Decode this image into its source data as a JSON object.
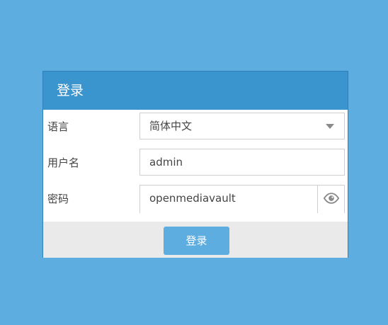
{
  "dialog": {
    "title": "登录"
  },
  "form": {
    "language": {
      "label": "语言",
      "value": "简体中文",
      "icon": "chevron-down-icon"
    },
    "username": {
      "label": "用户名",
      "value": "admin"
    },
    "password": {
      "label": "密码",
      "value": "openmediavault",
      "icon": "eye-icon"
    }
  },
  "footer": {
    "login_label": "登录"
  },
  "colors": {
    "background": "#5dade0",
    "header": "#3a95cf",
    "footer": "#eaeaea",
    "button": "#5dade0",
    "text": "#444444"
  }
}
